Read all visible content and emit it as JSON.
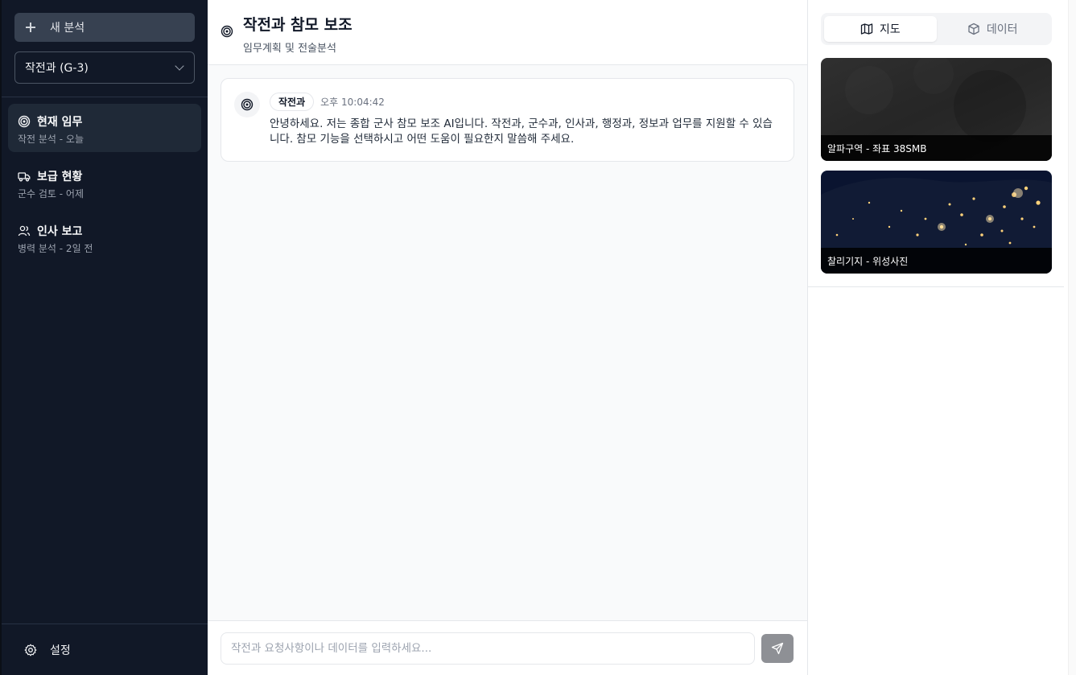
{
  "sidebar": {
    "new_button_label": "새 분석",
    "department_select": "작전과 (G-3)",
    "items": [
      {
        "title": "현재 임무",
        "subtitle": "작전 분석 - 오늘",
        "icon": "target-icon"
      },
      {
        "title": "보급 현황",
        "subtitle": "군수 검토 - 어제",
        "icon": "truck-icon"
      },
      {
        "title": "인사 보고",
        "subtitle": "병력 분석 - 2일 전",
        "icon": "users-icon"
      }
    ],
    "settings_label": "설정"
  },
  "header": {
    "title": "작전과 참모 보조",
    "subtitle": "임무계획 및 전술분석"
  },
  "messages": [
    {
      "sender": "작전과",
      "time": "오후 10:04:42",
      "text": "안녕하세요. 저는 종합 군사 참모 보조 AI입니다. 작전과, 군수과, 인사과, 행정과, 정보과 업무를 지원할 수 있습니다. 참모 기능을 선택하시고 어떤 도움이 필요한지 말씀해 주세요."
    }
  ],
  "composer": {
    "placeholder": "작전과 요청사항이나 데이터를 입력하세요..."
  },
  "right_panel": {
    "tabs": [
      {
        "label": "지도",
        "icon": "map-icon",
        "active": true
      },
      {
        "label": "데이터",
        "icon": "cube-icon",
        "active": false
      }
    ],
    "maps": [
      {
        "label": "알파구역 - 좌표 38SMB"
      },
      {
        "label": "찰리기지 - 위성사진"
      }
    ]
  },
  "colors": {
    "sidebar_bg": "#111827",
    "active_item_bg": "#1f2937",
    "send_button": "#8e9095"
  }
}
